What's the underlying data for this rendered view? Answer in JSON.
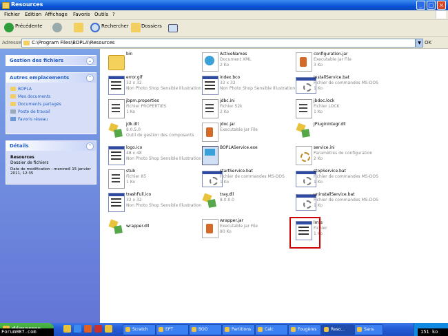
{
  "window": {
    "title": "Resources"
  },
  "menu": [
    "Fichier",
    "Edition",
    "Affichage",
    "Favoris",
    "Outils",
    "?"
  ],
  "toolbar": {
    "back": "Précédente",
    "search": "Rechercher",
    "folders": "Dossiers"
  },
  "address": {
    "label": "Adresse",
    "path": "C:\\Program Files\\BOPLA\\Resources",
    "go": "OK"
  },
  "sidebar": {
    "tasks_title": "Gestion des fichiers",
    "places_title": "Autres emplacements",
    "places": [
      "BOPLA",
      "Mes documents",
      "Documents partagés",
      "Poste de travail",
      "Favoris réseau"
    ],
    "details_title": "Détails",
    "details_name": "Resources",
    "details_type": "Dossier de fichiers",
    "details_modified": "Date de modification : mercredi 15 janvier 2011, 12:35"
  },
  "files": [
    {
      "name": "bin",
      "type": "",
      "size": "",
      "icon": "folder-icon"
    },
    {
      "name": "ActiveNames",
      "type": "Document XML",
      "size": "2 Ko",
      "icon": "xml-file-icon"
    },
    {
      "name": "configuration.jar",
      "type": "Executable Jar File",
      "size": "3 Ko",
      "icon": "jar-file-icon"
    },
    {
      "name": "error.gif",
      "type": "32 x 32",
      "size": "Non Photo Shop Sensible Illustration",
      "icon": "image-file-icon"
    },
    {
      "name": "index.bco",
      "type": "32 x 32",
      "size": "Non Photo Shop Sensible Illustration",
      "icon": "image-file-icon"
    },
    {
      "name": "InstallService.bat",
      "type": "Fichier de commandes MS-DOS",
      "size": "1 Ko",
      "icon": "batch-file-icon"
    },
    {
      "name": "jbpm.properties",
      "type": "Fichier PROPERTIES",
      "size": "1 Ko",
      "icon": "text-file-icon"
    },
    {
      "name": "jdbc.ini",
      "type": "Fichier 52k",
      "size": "2 Ko",
      "icon": "text-file-icon"
    },
    {
      "name": "jbdoc.lock",
      "type": "Fichier LOCK",
      "size": "1 Ko",
      "icon": "text-file-icon"
    },
    {
      "name": "jdk.dll",
      "type": "8.0.5.0",
      "size": "Outil de gestion des composants",
      "icon": "dll-file-icon"
    },
    {
      "name": "jdoc.jar",
      "type": "Executable Jar File",
      "size": "",
      "icon": "jar-file-icon"
    },
    {
      "name": "JPluginIntegr.dll",
      "type": "",
      "size": "",
      "icon": "dll-file-icon"
    },
    {
      "name": "logo.ico",
      "type": "48 x 48",
      "size": "Non Photo Shop Sensible Illustration",
      "icon": "image-file-icon"
    },
    {
      "name": "BOPLAService.exe",
      "type": "",
      "size": "",
      "icon": "exe-file-icon"
    },
    {
      "name": "service.ini",
      "type": "Paramètres de configuration",
      "size": "2 Ko",
      "icon": "ini-file-icon"
    },
    {
      "name": "stub",
      "type": "Fichier 85",
      "size": "1 Ko",
      "icon": "text-file-icon"
    },
    {
      "name": "startService.bat",
      "type": "Fichier de commandes MS-DOS",
      "size": "1 Ko",
      "icon": "batch-file-icon"
    },
    {
      "name": "stopService.bat",
      "type": "Fichier de commandes MS-DOS",
      "size": "1 Ko",
      "icon": "batch-file-icon"
    },
    {
      "name": "trashFull.ico",
      "type": "32 x 32",
      "size": "Non Photo Shop Sensible Illustration",
      "icon": "image-file-icon"
    },
    {
      "name": "tray.dll",
      "type": "8.0.0.0",
      "size": "",
      "icon": "dll-file-icon"
    },
    {
      "name": "uninstallService.bat",
      "type": "Fichier de commandes MS-DOS",
      "size": "1 Ko",
      "icon": "batch-file-icon"
    },
    {
      "name": "wrapper.dll",
      "type": "",
      "size": "",
      "icon": "dll-file-icon"
    },
    {
      "name": "wrapper.jar",
      "type": "Executable Jar File",
      "size": "80 Ko",
      "icon": "jar-file-icon"
    },
    {
      "name": "lmts",
      "type": "Fichier",
      "size": "1 Ko",
      "icon": "text-file-icon"
    }
  ],
  "taskbar": {
    "start": "démarrer",
    "tasks": [
      "Scratch",
      "EPT",
      "BOO",
      "Partitions",
      "Calc",
      "Fougères",
      "Reso...",
      "Sans"
    ]
  },
  "overlay": {
    "site": "Forum087.com",
    "size": "151 ko"
  }
}
